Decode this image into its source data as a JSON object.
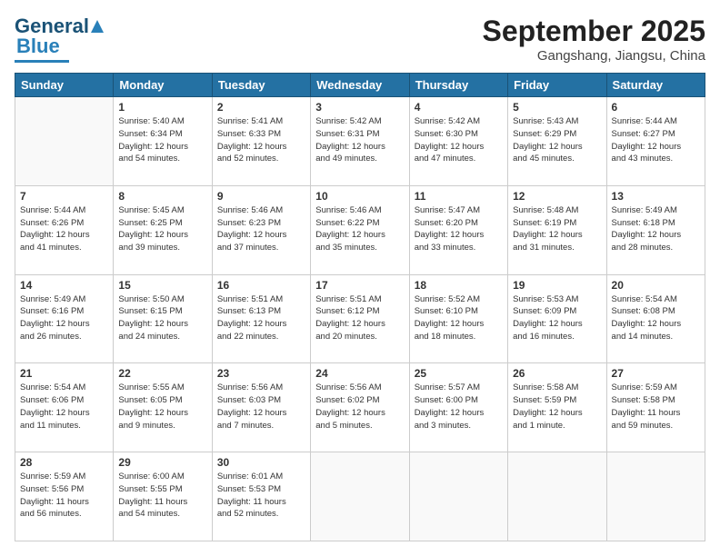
{
  "header": {
    "logo_general": "General",
    "logo_blue": "Blue",
    "month": "September 2025",
    "location": "Gangshang, Jiangsu, China"
  },
  "days": [
    "Sunday",
    "Monday",
    "Tuesday",
    "Wednesday",
    "Thursday",
    "Friday",
    "Saturday"
  ],
  "weeks": [
    [
      {
        "day": "",
        "info": ""
      },
      {
        "day": "1",
        "info": "Sunrise: 5:40 AM\nSunset: 6:34 PM\nDaylight: 12 hours\nand 54 minutes."
      },
      {
        "day": "2",
        "info": "Sunrise: 5:41 AM\nSunset: 6:33 PM\nDaylight: 12 hours\nand 52 minutes."
      },
      {
        "day": "3",
        "info": "Sunrise: 5:42 AM\nSunset: 6:31 PM\nDaylight: 12 hours\nand 49 minutes."
      },
      {
        "day": "4",
        "info": "Sunrise: 5:42 AM\nSunset: 6:30 PM\nDaylight: 12 hours\nand 47 minutes."
      },
      {
        "day": "5",
        "info": "Sunrise: 5:43 AM\nSunset: 6:29 PM\nDaylight: 12 hours\nand 45 minutes."
      },
      {
        "day": "6",
        "info": "Sunrise: 5:44 AM\nSunset: 6:27 PM\nDaylight: 12 hours\nand 43 minutes."
      }
    ],
    [
      {
        "day": "7",
        "info": "Sunrise: 5:44 AM\nSunset: 6:26 PM\nDaylight: 12 hours\nand 41 minutes."
      },
      {
        "day": "8",
        "info": "Sunrise: 5:45 AM\nSunset: 6:25 PM\nDaylight: 12 hours\nand 39 minutes."
      },
      {
        "day": "9",
        "info": "Sunrise: 5:46 AM\nSunset: 6:23 PM\nDaylight: 12 hours\nand 37 minutes."
      },
      {
        "day": "10",
        "info": "Sunrise: 5:46 AM\nSunset: 6:22 PM\nDaylight: 12 hours\nand 35 minutes."
      },
      {
        "day": "11",
        "info": "Sunrise: 5:47 AM\nSunset: 6:20 PM\nDaylight: 12 hours\nand 33 minutes."
      },
      {
        "day": "12",
        "info": "Sunrise: 5:48 AM\nSunset: 6:19 PM\nDaylight: 12 hours\nand 31 minutes."
      },
      {
        "day": "13",
        "info": "Sunrise: 5:49 AM\nSunset: 6:18 PM\nDaylight: 12 hours\nand 28 minutes."
      }
    ],
    [
      {
        "day": "14",
        "info": "Sunrise: 5:49 AM\nSunset: 6:16 PM\nDaylight: 12 hours\nand 26 minutes."
      },
      {
        "day": "15",
        "info": "Sunrise: 5:50 AM\nSunset: 6:15 PM\nDaylight: 12 hours\nand 24 minutes."
      },
      {
        "day": "16",
        "info": "Sunrise: 5:51 AM\nSunset: 6:13 PM\nDaylight: 12 hours\nand 22 minutes."
      },
      {
        "day": "17",
        "info": "Sunrise: 5:51 AM\nSunset: 6:12 PM\nDaylight: 12 hours\nand 20 minutes."
      },
      {
        "day": "18",
        "info": "Sunrise: 5:52 AM\nSunset: 6:10 PM\nDaylight: 12 hours\nand 18 minutes."
      },
      {
        "day": "19",
        "info": "Sunrise: 5:53 AM\nSunset: 6:09 PM\nDaylight: 12 hours\nand 16 minutes."
      },
      {
        "day": "20",
        "info": "Sunrise: 5:54 AM\nSunset: 6:08 PM\nDaylight: 12 hours\nand 14 minutes."
      }
    ],
    [
      {
        "day": "21",
        "info": "Sunrise: 5:54 AM\nSunset: 6:06 PM\nDaylight: 12 hours\nand 11 minutes."
      },
      {
        "day": "22",
        "info": "Sunrise: 5:55 AM\nSunset: 6:05 PM\nDaylight: 12 hours\nand 9 minutes."
      },
      {
        "day": "23",
        "info": "Sunrise: 5:56 AM\nSunset: 6:03 PM\nDaylight: 12 hours\nand 7 minutes."
      },
      {
        "day": "24",
        "info": "Sunrise: 5:56 AM\nSunset: 6:02 PM\nDaylight: 12 hours\nand 5 minutes."
      },
      {
        "day": "25",
        "info": "Sunrise: 5:57 AM\nSunset: 6:00 PM\nDaylight: 12 hours\nand 3 minutes."
      },
      {
        "day": "26",
        "info": "Sunrise: 5:58 AM\nSunset: 5:59 PM\nDaylight: 12 hours\nand 1 minute."
      },
      {
        "day": "27",
        "info": "Sunrise: 5:59 AM\nSunset: 5:58 PM\nDaylight: 11 hours\nand 59 minutes."
      }
    ],
    [
      {
        "day": "28",
        "info": "Sunrise: 5:59 AM\nSunset: 5:56 PM\nDaylight: 11 hours\nand 56 minutes."
      },
      {
        "day": "29",
        "info": "Sunrise: 6:00 AM\nSunset: 5:55 PM\nDaylight: 11 hours\nand 54 minutes."
      },
      {
        "day": "30",
        "info": "Sunrise: 6:01 AM\nSunset: 5:53 PM\nDaylight: 11 hours\nand 52 minutes."
      },
      {
        "day": "",
        "info": ""
      },
      {
        "day": "",
        "info": ""
      },
      {
        "day": "",
        "info": ""
      },
      {
        "day": "",
        "info": ""
      }
    ]
  ]
}
